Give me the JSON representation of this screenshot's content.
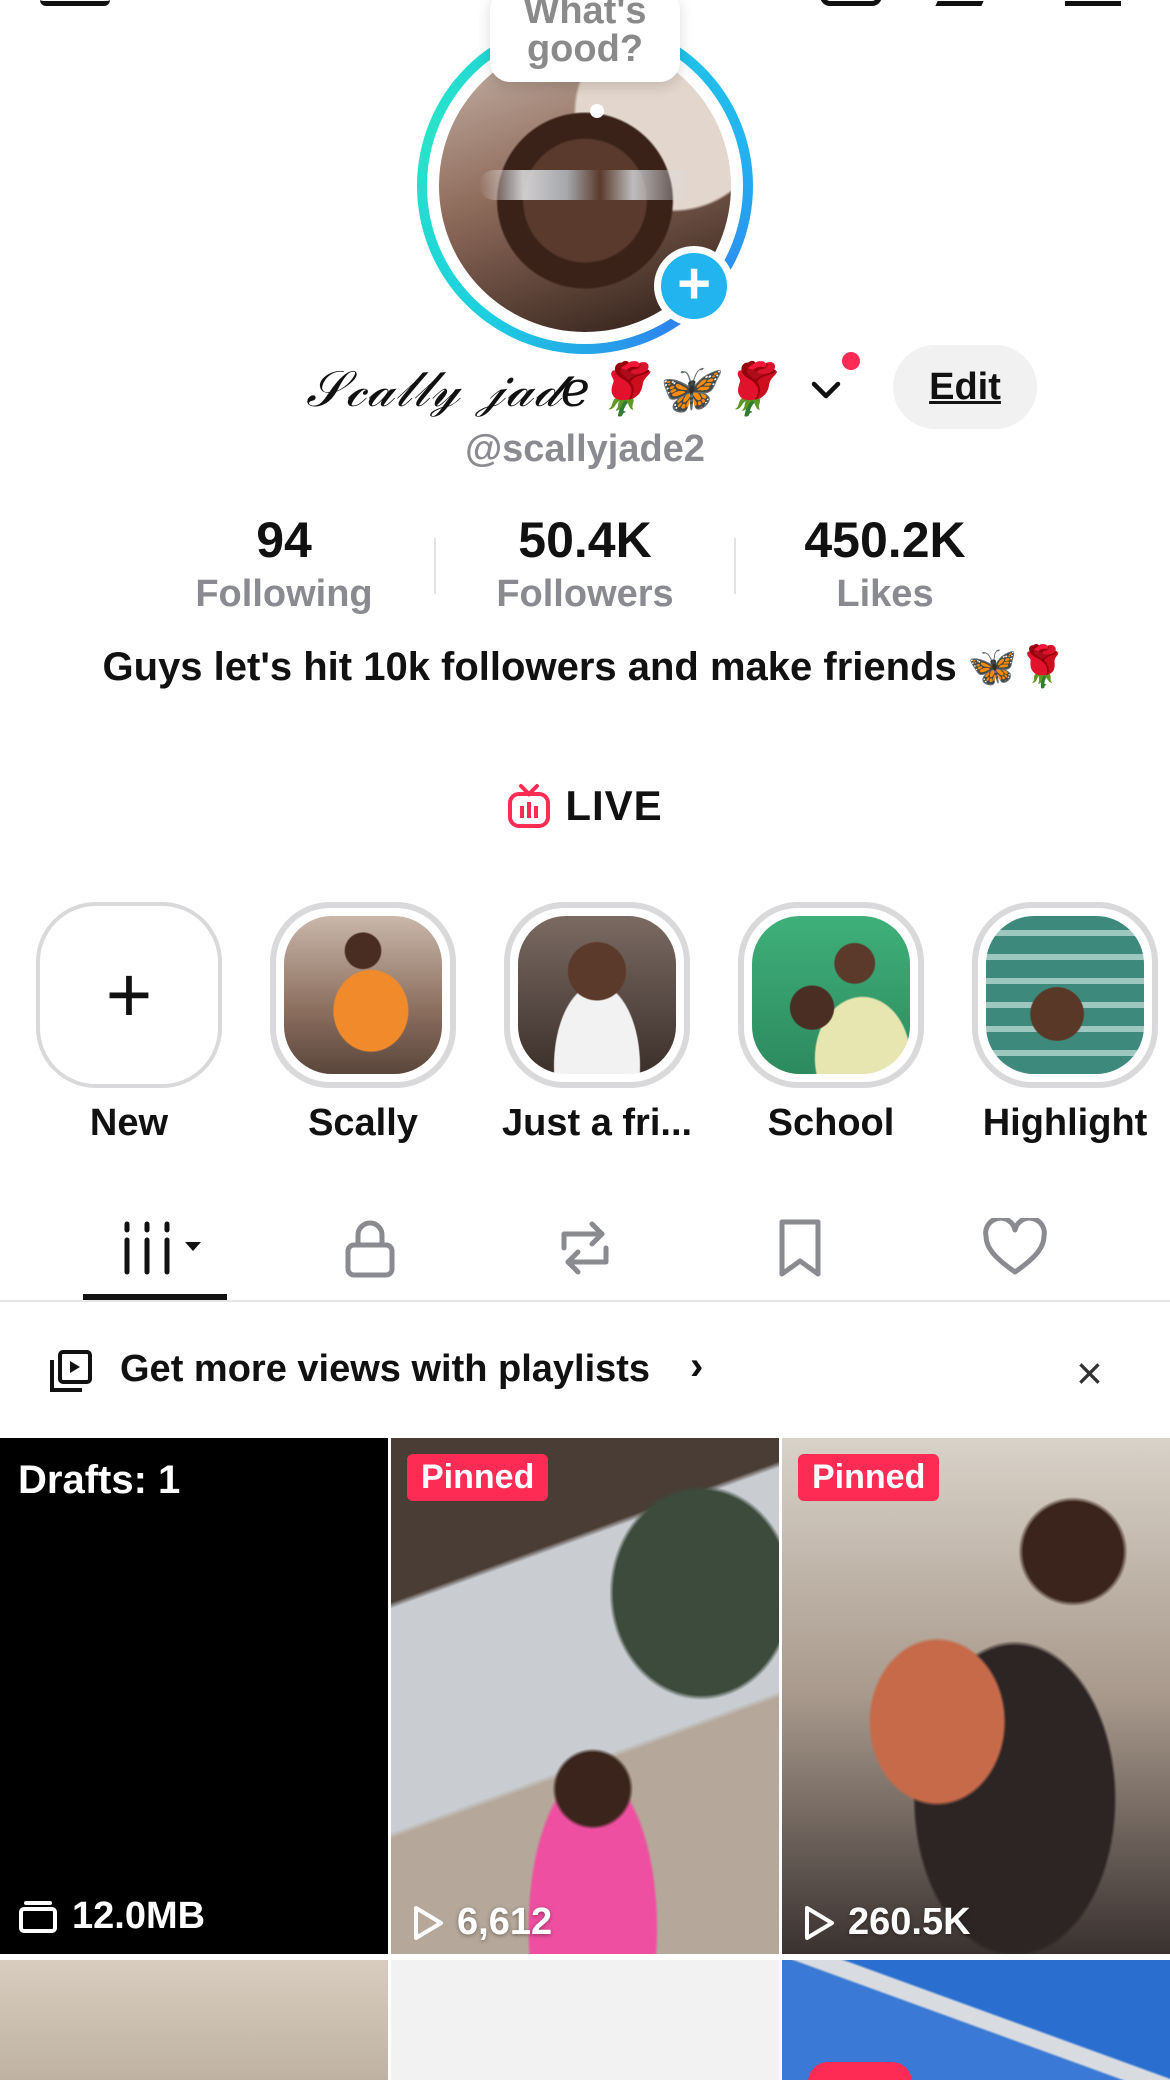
{
  "profile": {
    "bubble_text": "What's good?",
    "display_name": "𝒮𝒸𝒶𝓁𝓁𝓎 𝒿𝒶𝒹𝑒🌹🦋🌹",
    "username": "@scallyjade2",
    "edit_label": "Edit",
    "bio": "Guys let's hit 10k followers and make friends 🦋🌹"
  },
  "stats": [
    {
      "value": "94",
      "label": "Following"
    },
    {
      "value": "50.4K",
      "label": "Followers"
    },
    {
      "value": "450.2K",
      "label": "Likes"
    }
  ],
  "live": {
    "label": "LIVE",
    "accent": "#fe2c55"
  },
  "highlights": [
    {
      "label": "New",
      "icon": "plus-icon"
    },
    {
      "label": "Scally"
    },
    {
      "label": "Just a fri..."
    },
    {
      "label": "School"
    },
    {
      "label": "Highlight"
    }
  ],
  "tabs": [
    {
      "name": "videos",
      "icon": "grid-bars-icon",
      "active": true
    },
    {
      "name": "private",
      "icon": "lock-icon"
    },
    {
      "name": "reposts",
      "icon": "repost-icon"
    },
    {
      "name": "favorites",
      "icon": "bookmark-icon"
    },
    {
      "name": "liked",
      "icon": "heart-icon"
    }
  ],
  "banner": {
    "text": "Get more views with playlists",
    "arrow": "›",
    "close": "×"
  },
  "grid": {
    "drafts": {
      "label": "Drafts: 1",
      "size": "12.0MB"
    },
    "videos": [
      {
        "badge": "Pinned",
        "views": "6,612"
      },
      {
        "badge": "Pinned",
        "views": "260.5K"
      }
    ]
  },
  "colors": {
    "accent": "#fe2c55",
    "ring": "#1ccfe0",
    "add_badge": "#21b4ee",
    "muted": "#8a8b91"
  }
}
